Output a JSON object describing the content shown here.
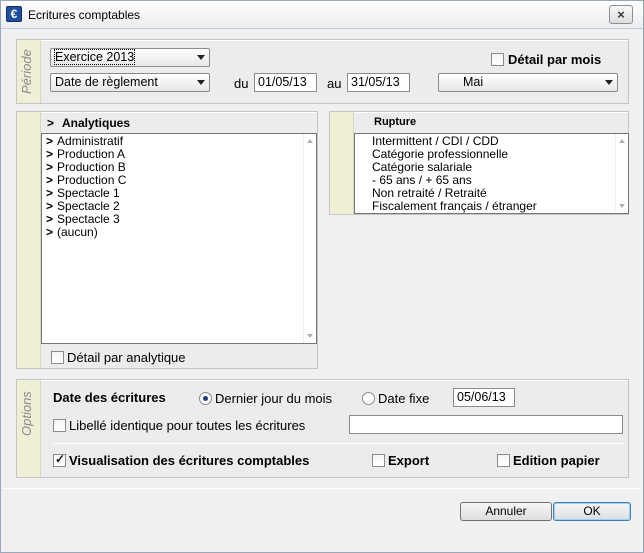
{
  "window": {
    "title": "Ecritures comptables",
    "icon_letter": "€",
    "close_glyph": "×"
  },
  "periode": {
    "section_label": "Période",
    "exercice_value": "Exercice 2013",
    "date_type_value": "Date de règlement",
    "du_label": "du",
    "du_value": "01/05/13",
    "au_label": "au",
    "au_value": "31/05/13",
    "month_value": "Mai",
    "detail_par_mois_label": "Détail par mois",
    "detail_par_mois_checked": false
  },
  "analytiques": {
    "header": "Analytiques",
    "header_marker": ">",
    "item_marker": ">",
    "items": [
      "Administratif",
      "Production A",
      "Production B",
      "Production C",
      "Spectacle 1",
      "Spectacle 2",
      "Spectacle 3",
      "(aucun)"
    ],
    "detail_label": "Détail par analytique",
    "detail_checked": false
  },
  "rupture": {
    "header": "Rupture",
    "items": [
      "Intermittent / CDI / CDD",
      "Catégorie professionnelle",
      "Catégorie salariale",
      "- 65 ans / + 65 ans",
      "Non retraité / Retraité",
      "Fiscalement français / étranger"
    ]
  },
  "options": {
    "section_label": "Options",
    "date_ecritures_label": "Date des écritures",
    "radio_dernier_jour_label": "Dernier jour du mois",
    "radio_dernier_jour_selected": true,
    "radio_date_fixe_label": "Date fixe",
    "date_fixe_value": "05/06/13",
    "libelle_label": "Libellé identique pour toutes les écritures",
    "libelle_checked": false,
    "libelle_value": "",
    "visualisation_label": "Visualisation des écritures comptables",
    "visualisation_checked": true,
    "export_label": "Export",
    "export_checked": false,
    "edition_label": "Edition papier",
    "edition_checked": false
  },
  "buttons": {
    "annuler": "Annuler",
    "ok": "OK"
  }
}
